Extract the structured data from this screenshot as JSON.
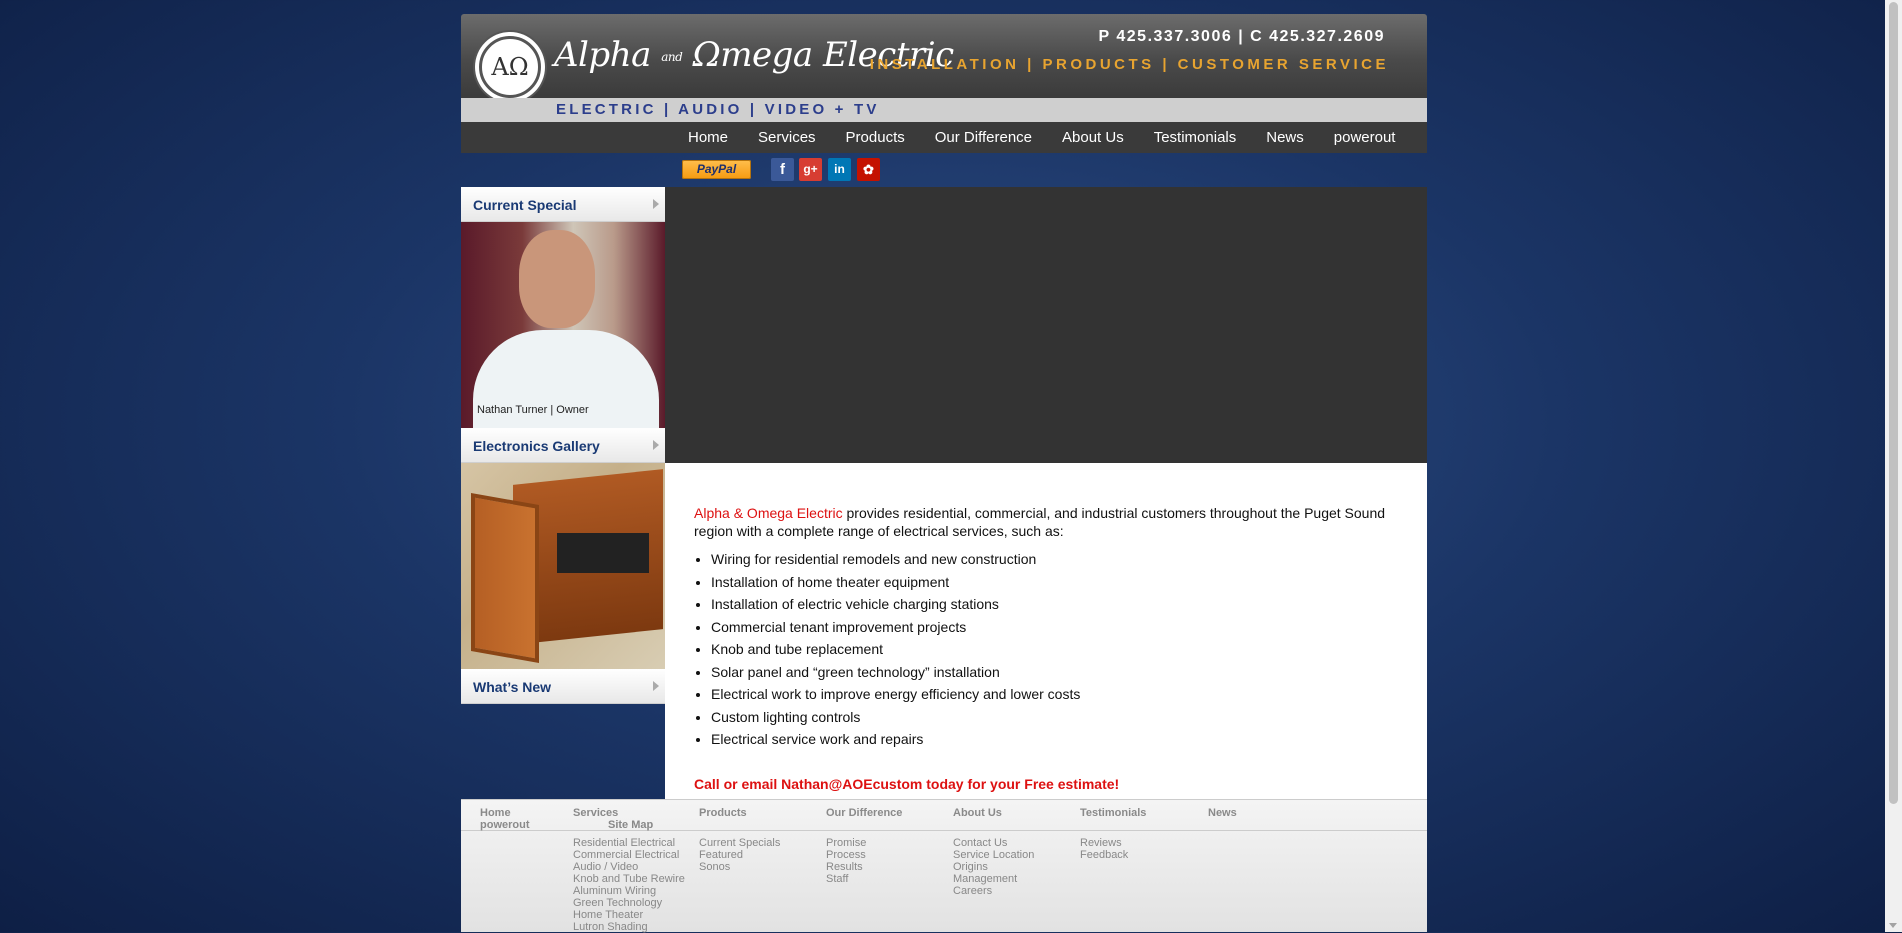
{
  "header": {
    "logo_monogram": "AΩ",
    "logo_name_a": "Alpha",
    "logo_and": "and",
    "logo_name_b": "Ωmega Electric",
    "phone": "P 425.337.3006 | C 425.327.2609",
    "services_line": "INSTALLATION | PRODUCTS | CUSTOMER SERVICE",
    "tagline": "ELECTRIC | AUDIO | VIDEO + TV"
  },
  "nav": [
    "Home",
    "Services",
    "Products",
    "Our Difference",
    "About Us",
    "Testimonials",
    "News",
    "powerout"
  ],
  "social": {
    "paypal_label": "PayPal",
    "facebook_glyph": "f",
    "googleplus_glyph": "g+",
    "linkedin_glyph": "in",
    "yelp_glyph": "✿"
  },
  "sidebar": {
    "current_special": "Current Special",
    "owner_caption": "Nathan Turner | Owner",
    "electronics_gallery": "Electronics Gallery",
    "whats_new": "What’s New"
  },
  "content": {
    "brand": "Alpha & Omega Electric",
    "intro": " provides residential, commercial, and industrial customers throughout the Puget Sound region with a complete range of electrical services, such as:",
    "services": [
      "Wiring for residential remodels and new construction",
      "Installation of home theater equipment",
      "Installation of electric vehicle charging stations",
      "Commercial tenant improvement projects",
      "Knob and tube replacement",
      "Solar panel and “green technology” installation",
      "Electrical work to improve energy efficiency and lower costs",
      "Custom lighting controls",
      "Electrical service work and repairs"
    ],
    "cta": "Call or email Nathan@AOEcustom today for your Free estimate!"
  },
  "footer": {
    "sitemap": "Site Map",
    "col_home": "Home",
    "col_home_2": "powerout",
    "col_services": "Services",
    "services_items": [
      "Residential Electrical",
      "Commercial Electrical",
      "Audio / Video",
      "Knob and Tube Rewire",
      "Aluminum Wiring",
      "Green Technology",
      "Home Theater",
      "Lutron Shading"
    ],
    "col_products": "Products",
    "products_items": [
      "Current Specials",
      "Featured",
      "Sonos"
    ],
    "col_difference": "Our Difference",
    "difference_items": [
      "Promise",
      "Process",
      "Results",
      "Staff"
    ],
    "col_about": "About Us",
    "about_items": [
      "Contact Us",
      "Service Location",
      "Origins",
      "Management",
      "Careers"
    ],
    "col_testimonials": "Testimonials",
    "testimonials_items": [
      "Reviews",
      "Feedback"
    ],
    "col_news": "News"
  }
}
